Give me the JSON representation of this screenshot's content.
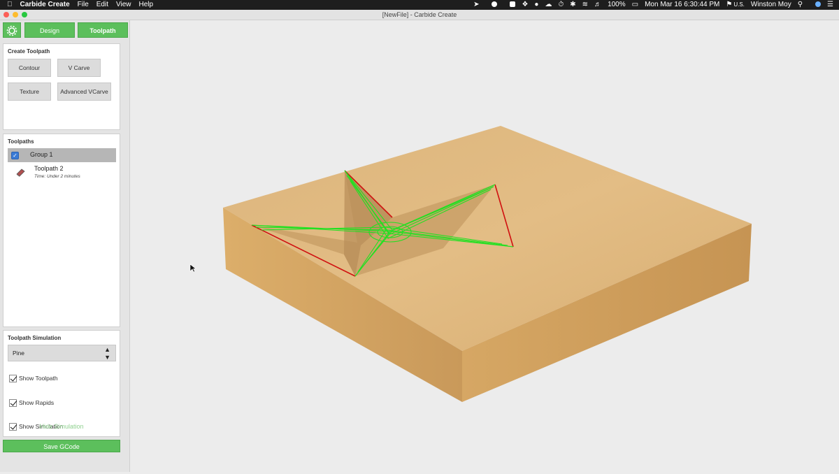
{
  "menubar": {
    "app_name": "Carbide Create",
    "menus": [
      "File",
      "Edit",
      "View",
      "Help"
    ],
    "battery": "100%",
    "datetime": "Mon Mar 16  6:30:44 PM",
    "input_source": "U.S.",
    "user": "Winston Moy"
  },
  "window": {
    "title": "[NewFile] - Carbide Create"
  },
  "tabs": {
    "design": "Design",
    "toolpath": "Toolpath"
  },
  "create_toolpath": {
    "title": "Create Toolpath",
    "buttons": [
      "Contour",
      "V Carve",
      "Texture",
      "Advanced VCarve"
    ]
  },
  "toolpaths": {
    "title": "Toolpaths",
    "group_label": "Group 1",
    "item_name": "Toolpath 2",
    "item_time": "Time: Under 2 minutes"
  },
  "simulation": {
    "title": "Toolpath Simulation",
    "material": "Pine",
    "options": [
      "Show Toolpath",
      "Show Rapids",
      "Show Simulation"
    ],
    "hide_link": "Hide Simulation"
  },
  "save_button": "Save GCode",
  "colors": {
    "accent_green": "#5cbf5c",
    "toolpath_green": "#22e022",
    "edge_red": "#d01010",
    "wood": "#d9ad6e"
  }
}
